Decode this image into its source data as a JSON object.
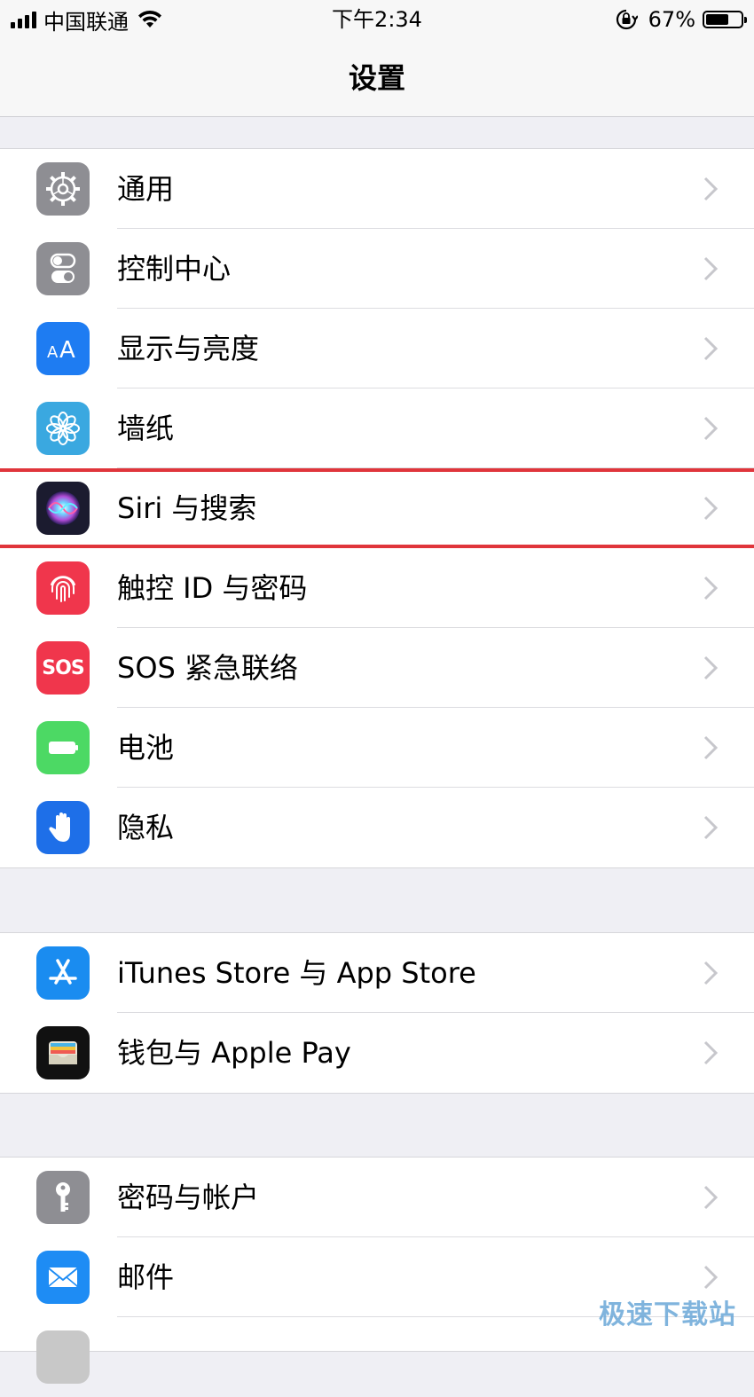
{
  "status_bar": {
    "carrier": "中国联通",
    "time": "下午2:34",
    "battery_percent": "67%",
    "battery_level": 0.67
  },
  "nav": {
    "title": "设置"
  },
  "groups": [
    {
      "items": [
        {
          "label": "通用",
          "icon": "gear-icon",
          "color": "#8e8e93"
        },
        {
          "label": "控制中心",
          "icon": "toggles-icon",
          "color": "#8e8e93"
        },
        {
          "label": "显示与亮度",
          "icon": "text-size-icon",
          "color": "#1e7cf2"
        },
        {
          "label": "墙纸",
          "icon": "flower-icon",
          "color": "#3aa8e0"
        },
        {
          "label": "Siri 与搜索",
          "icon": "siri-icon",
          "color": "#1b1b2f"
        },
        {
          "label": "触控 ID 与密码",
          "icon": "fingerprint-icon",
          "color": "#f0364c"
        },
        {
          "label": "SOS 紧急联络",
          "icon": "sos-icon",
          "color": "#f0364c",
          "icon_text": "SOS"
        },
        {
          "label": "电池",
          "icon": "battery-icon",
          "color": "#4cd964"
        },
        {
          "label": "隐私",
          "icon": "hand-icon",
          "color": "#1e6fe8"
        }
      ]
    },
    {
      "items": [
        {
          "label": "iTunes Store 与 App Store",
          "icon": "app-store-icon",
          "color": "#1a8cf0"
        },
        {
          "label": "钱包与 Apple Pay",
          "icon": "wallet-icon",
          "color": "#111111"
        }
      ]
    },
    {
      "items": [
        {
          "label": "密码与帐户",
          "icon": "key-icon",
          "color": "#8e8e93"
        },
        {
          "label": "邮件",
          "icon": "mail-icon",
          "color": "#1e8cf4"
        }
      ]
    }
  ],
  "watermark": "极速下载站"
}
